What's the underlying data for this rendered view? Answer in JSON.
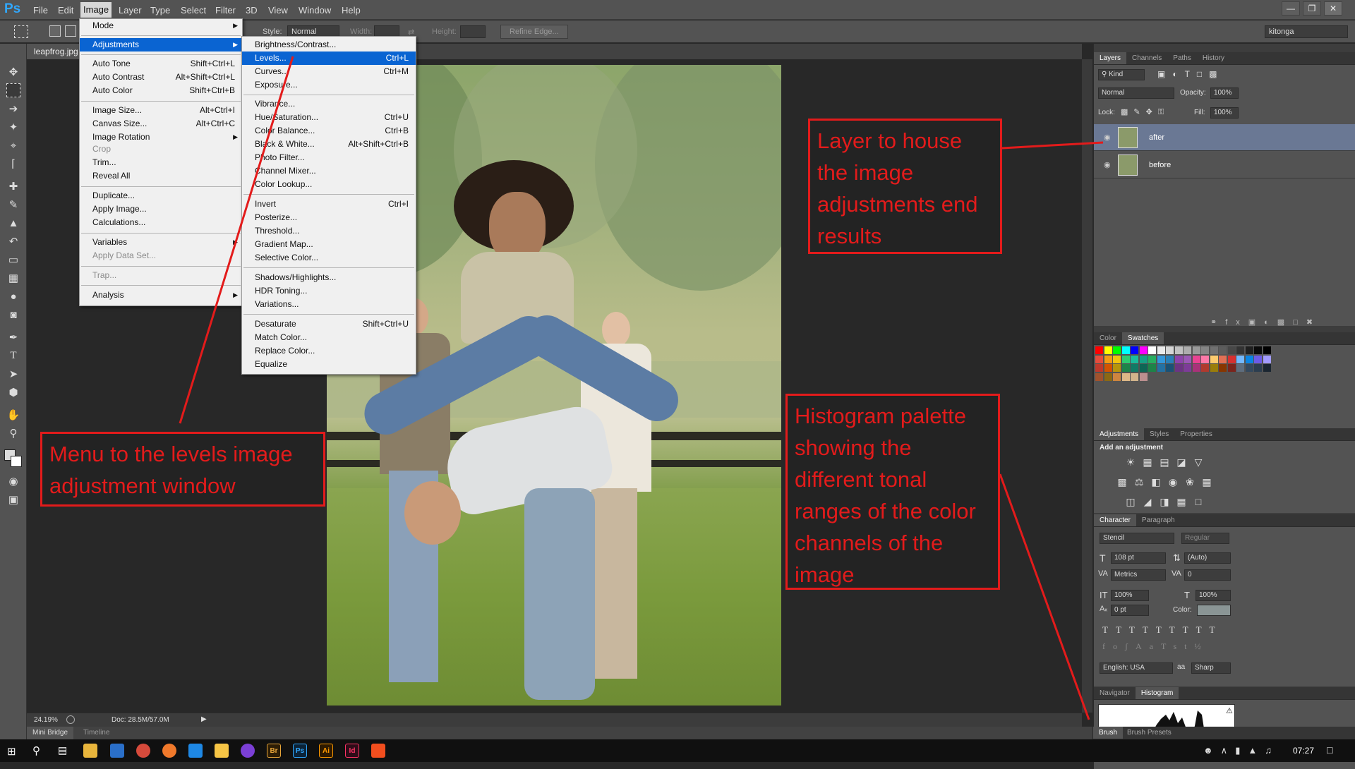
{
  "app": {
    "logo": "Ps",
    "workspace": "kitonga"
  },
  "menubar": [
    "File",
    "Edit",
    "Image",
    "Layer",
    "Type",
    "Select",
    "Filter",
    "3D",
    "View",
    "Window",
    "Help"
  ],
  "options": {
    "style_label": "Style:",
    "style_value": "Normal",
    "width_label": "Width:",
    "height_label": "Height:",
    "refine_edge": "Refine Edge..."
  },
  "document": {
    "tab": "leapfrog.jpg",
    "zoom": "24.19%",
    "doc_info": "Doc: 28.5M/57.0M"
  },
  "bottom_tabs": [
    "Mini Bridge",
    "Timeline"
  ],
  "image_menu": {
    "items": [
      {
        "label": "Mode",
        "shortcut": "",
        "submenu": true
      },
      {
        "label": "Adjustments",
        "shortcut": "",
        "submenu": true,
        "highlight": true
      },
      {
        "label": "Auto Tone",
        "shortcut": "Shift+Ctrl+L"
      },
      {
        "label": "Auto Contrast",
        "shortcut": "Alt+Shift+Ctrl+L"
      },
      {
        "label": "Auto Color",
        "shortcut": "Shift+Ctrl+B"
      },
      {
        "label": "Image Size...",
        "shortcut": "Alt+Ctrl+I"
      },
      {
        "label": "Canvas Size...",
        "shortcut": "Alt+Ctrl+C"
      },
      {
        "label": "Image Rotation",
        "shortcut": "",
        "submenu": true
      },
      {
        "label": "Crop",
        "shortcut": "",
        "disabled": true
      },
      {
        "label": "Trim...",
        "shortcut": ""
      },
      {
        "label": "Reveal All",
        "shortcut": ""
      },
      {
        "label": "Duplicate...",
        "shortcut": ""
      },
      {
        "label": "Apply Image...",
        "shortcut": ""
      },
      {
        "label": "Calculations...",
        "shortcut": ""
      },
      {
        "label": "Variables",
        "shortcut": "",
        "submenu": true
      },
      {
        "label": "Apply Data Set...",
        "shortcut": "",
        "disabled": true
      },
      {
        "label": "Trap...",
        "shortcut": "",
        "disabled": true
      },
      {
        "label": "Analysis",
        "shortcut": "",
        "submenu": true
      }
    ]
  },
  "adjust_menu": {
    "items": [
      {
        "label": "Brightness/Contrast...",
        "shortcut": ""
      },
      {
        "label": "Levels...",
        "shortcut": "Ctrl+L",
        "highlight": true
      },
      {
        "label": "Curves...",
        "shortcut": "Ctrl+M"
      },
      {
        "label": "Exposure...",
        "shortcut": ""
      },
      {
        "label": "Vibrance...",
        "shortcut": ""
      },
      {
        "label": "Hue/Saturation...",
        "shortcut": "Ctrl+U"
      },
      {
        "label": "Color Balance...",
        "shortcut": "Ctrl+B"
      },
      {
        "label": "Black & White...",
        "shortcut": "Alt+Shift+Ctrl+B"
      },
      {
        "label": "Photo Filter...",
        "shortcut": ""
      },
      {
        "label": "Channel Mixer...",
        "shortcut": ""
      },
      {
        "label": "Color Lookup...",
        "shortcut": ""
      },
      {
        "label": "Invert",
        "shortcut": "Ctrl+I"
      },
      {
        "label": "Posterize...",
        "shortcut": ""
      },
      {
        "label": "Threshold...",
        "shortcut": ""
      },
      {
        "label": "Gradient Map...",
        "shortcut": ""
      },
      {
        "label": "Selective Color...",
        "shortcut": ""
      },
      {
        "label": "Shadows/Highlights...",
        "shortcut": ""
      },
      {
        "label": "HDR Toning...",
        "shortcut": ""
      },
      {
        "label": "Variations...",
        "shortcut": ""
      },
      {
        "label": "Desaturate",
        "shortcut": "Shift+Ctrl+U"
      },
      {
        "label": "Match Color...",
        "shortcut": ""
      },
      {
        "label": "Replace Color...",
        "shortcut": ""
      },
      {
        "label": "Equalize",
        "shortcut": ""
      }
    ]
  },
  "layers_panel": {
    "tabs": [
      "Layers",
      "Channels",
      "Paths",
      "History"
    ],
    "kind": "Kind",
    "blend": "Normal",
    "opacity_label": "Opacity:",
    "opacity": "100%",
    "lock_label": "Lock:",
    "fill_label": "Fill:",
    "fill": "100%",
    "layers": [
      {
        "name": "after",
        "selected": true
      },
      {
        "name": "before",
        "selected": false
      }
    ]
  },
  "color_panel": {
    "tabs": [
      "Color",
      "Swatches"
    ]
  },
  "adjustments_panel": {
    "tabs": [
      "Adjustments",
      "Styles",
      "Properties"
    ],
    "title": "Add an adjustment"
  },
  "character_panel": {
    "tabs": [
      "Character",
      "Paragraph"
    ],
    "font": "Stencil",
    "style": "Regular",
    "size": "108 pt",
    "leading": "(Auto)",
    "kerning": "Metrics",
    "tracking": "0",
    "vscale": "100%",
    "hscale": "100%",
    "baseline": "0 pt",
    "color_label": "Color:",
    "language": "English: USA",
    "aa_label": "a",
    "antialias": "Sharp"
  },
  "navigator_panel": {
    "tabs": [
      "Navigator",
      "Histogram"
    ]
  },
  "brush_panel": {
    "tabs": [
      "Brush",
      "Brush Presets"
    ]
  },
  "annotations": {
    "layer": "Layer to house the image adjustments end results",
    "menu": "Menu to the levels image adjustment window",
    "histogram": "Histogram palette showing the different tonal ranges of the color channels of the image"
  },
  "taskbar": {
    "time": "07:27"
  },
  "colors": {
    "accent": "#0a64d2",
    "annotation": "#e31b1b",
    "ps_blue": "#31a8ff"
  }
}
